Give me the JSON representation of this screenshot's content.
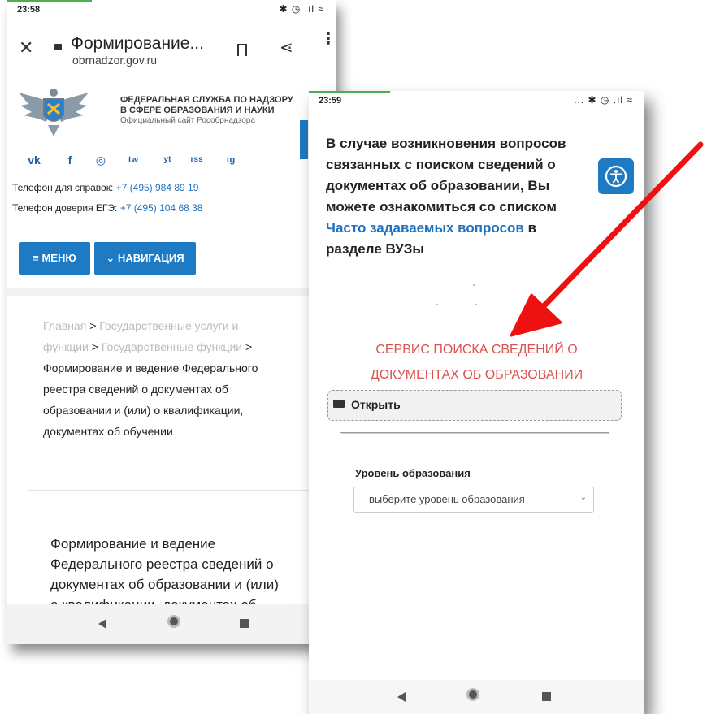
{
  "left_screen": {
    "status": {
      "time": "23:58",
      "icons": "✱ ◷ .ıl ≈"
    },
    "browser": {
      "page_title": "Формирование...",
      "domain": "obrnadzor.gov.ru"
    },
    "header": {
      "org_line1": "ФЕДЕРАЛЬНАЯ СЛУЖБА ПО НАДЗОРУ",
      "org_line2": "В СФЕРЕ ОБРАЗОВАНИЯ И НАУКИ",
      "org_subtitle": "Официальный сайт Рособрнадзора"
    },
    "social": [
      "vk",
      "f",
      "◎",
      "tw",
      "yt",
      "rss",
      "tg"
    ],
    "phones": {
      "info_label": "Телефон для справок: ",
      "info_number": "+7 (495) 984 89 19",
      "hotline_label": "Телефон доверия ЕГЭ: ",
      "hotline_number": "+7 (495) 104 68 38"
    },
    "menu_button": "≡ МЕНЮ",
    "nav_button": "⌄ НАВИГАЦИЯ",
    "breadcrumb": {
      "home": "Главная",
      "gt": ">",
      "services_a": "Государственные услуги и",
      "services_b": "функции",
      "functions": "Государственные функции",
      "current_1": "Формирование и ведение Федерального",
      "current_2": "реестра сведений о документах об",
      "current_3": "образовании и (или) о квалификации,",
      "current_4": "документах об обучении"
    },
    "content": {
      "line1": "Формирование и ведение",
      "line2": "Федерального реестра сведений о",
      "line3": "документах об образовании и (или)",
      "line4": "о квалификации, документах об"
    }
  },
  "right_screen": {
    "status": {
      "time": "23:59",
      "icons": "... ✱ ◷ .ıl ≈"
    },
    "intro": {
      "line1": "В случае возникновения вопросов",
      "line2": "связанных с поиском сведений о",
      "line3": "документах об образовании, Вы",
      "line4": "можете ознакомиться со списком",
      "link": "Часто задаваемых вопросов",
      "after_link": " в",
      "line6": "разделе ВУЗы"
    },
    "service_title_1": "СЕРВИС ПОИСКА СВЕДЕНИЙ О",
    "service_title_2": "ДОКУМЕНТАХ ОБ ОБРАЗОВАНИИ",
    "open_label": "Открыть",
    "level_label": "Уровень образования",
    "level_select": "выберите уровень образования"
  },
  "colors": {
    "accent_blue": "#1f7ac4",
    "link_blue": "#1e73be",
    "service_red": "#d9534f",
    "arrow_red": "#ee1111"
  }
}
